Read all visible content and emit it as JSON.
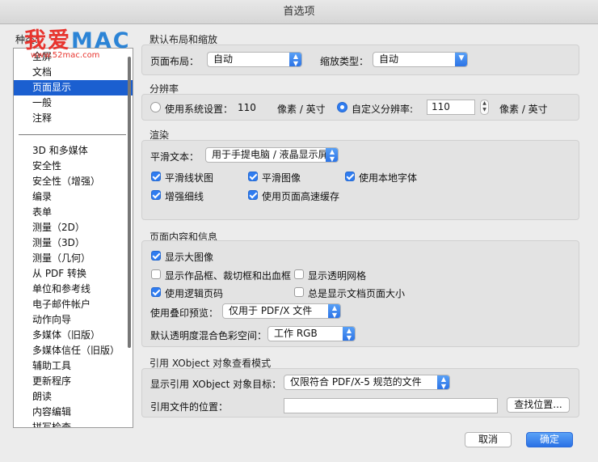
{
  "window": {
    "title": "首选项"
  },
  "watermark": {
    "cn": "我爱",
    "en": "MAC",
    "url": "www.52mac.com"
  },
  "sidebar": {
    "label": "种类:",
    "group1": [
      "全屏",
      "文档",
      "页面显示",
      "一般",
      "注释"
    ],
    "selected_index": 2,
    "group2": [
      "3D 和多媒体",
      "安全性",
      "安全性（增强）",
      "编录",
      "表单",
      "测量（2D）",
      "测量（3D）",
      "测量（几何）",
      "从 PDF 转换",
      "单位和参考线",
      "电子邮件帐户",
      "动作向导",
      "多媒体（旧版）",
      "多媒体信任（旧版）",
      "辅助工具",
      "更新程序",
      "朗读",
      "内容编辑",
      "拼写检查"
    ]
  },
  "layout": {
    "title": "默认布局和缩放",
    "page_layout_label": "页面布局：",
    "page_layout_value": "自动",
    "zoom_label": "缩放类型：",
    "zoom_value": "自动"
  },
  "resolution": {
    "title": "分辨率",
    "system_label": "使用系统设置：",
    "system_value": "110",
    "system_unit": "像素 / 英寸",
    "custom_label": "自定义分辨率:",
    "custom_value": "110",
    "custom_unit": "像素 / 英寸",
    "selected": "custom"
  },
  "rendering": {
    "title": "渲染",
    "smooth_label": "平滑文本：",
    "smooth_value": "用于手提电脑 / 液晶显示屏",
    "options": [
      {
        "label": "平滑线状图",
        "checked": true
      },
      {
        "label": "平滑图像",
        "checked": true
      },
      {
        "label": "使用本地字体",
        "checked": true
      },
      {
        "label": "增强细线",
        "checked": true
      },
      {
        "label": "使用页面高速缓存",
        "checked": true
      }
    ]
  },
  "page_content": {
    "title": "页面内容和信息",
    "options": [
      {
        "label": "显示大图像",
        "checked": true
      },
      {
        "label": "显示作品框、裁切框和出血框",
        "checked": false
      },
      {
        "label": "显示透明网格",
        "checked": false
      },
      {
        "label": "使用逻辑页码",
        "checked": true
      },
      {
        "label": "总是显示文档页面大小",
        "checked": false
      }
    ],
    "overprint_label": "使用叠印预览：",
    "overprint_value": "仅用于 PDF/X 文件",
    "blend_label": "默认透明度混合色彩空间：",
    "blend_value": "工作 RGB"
  },
  "xobject": {
    "title": "引用 XObject 对象查看模式",
    "target_label": "显示引用 XObject 对象目标：",
    "target_value": "仅限符合 PDF/X-5 规范的文件",
    "location_label": "引用文件的位置：",
    "location_value": "",
    "browse_label": "查找位置..."
  },
  "footer": {
    "cancel_label": "取消",
    "ok_label": "确定"
  },
  "colors": {
    "accent": "#2f7cf0",
    "selection": "#1b5fd0"
  }
}
